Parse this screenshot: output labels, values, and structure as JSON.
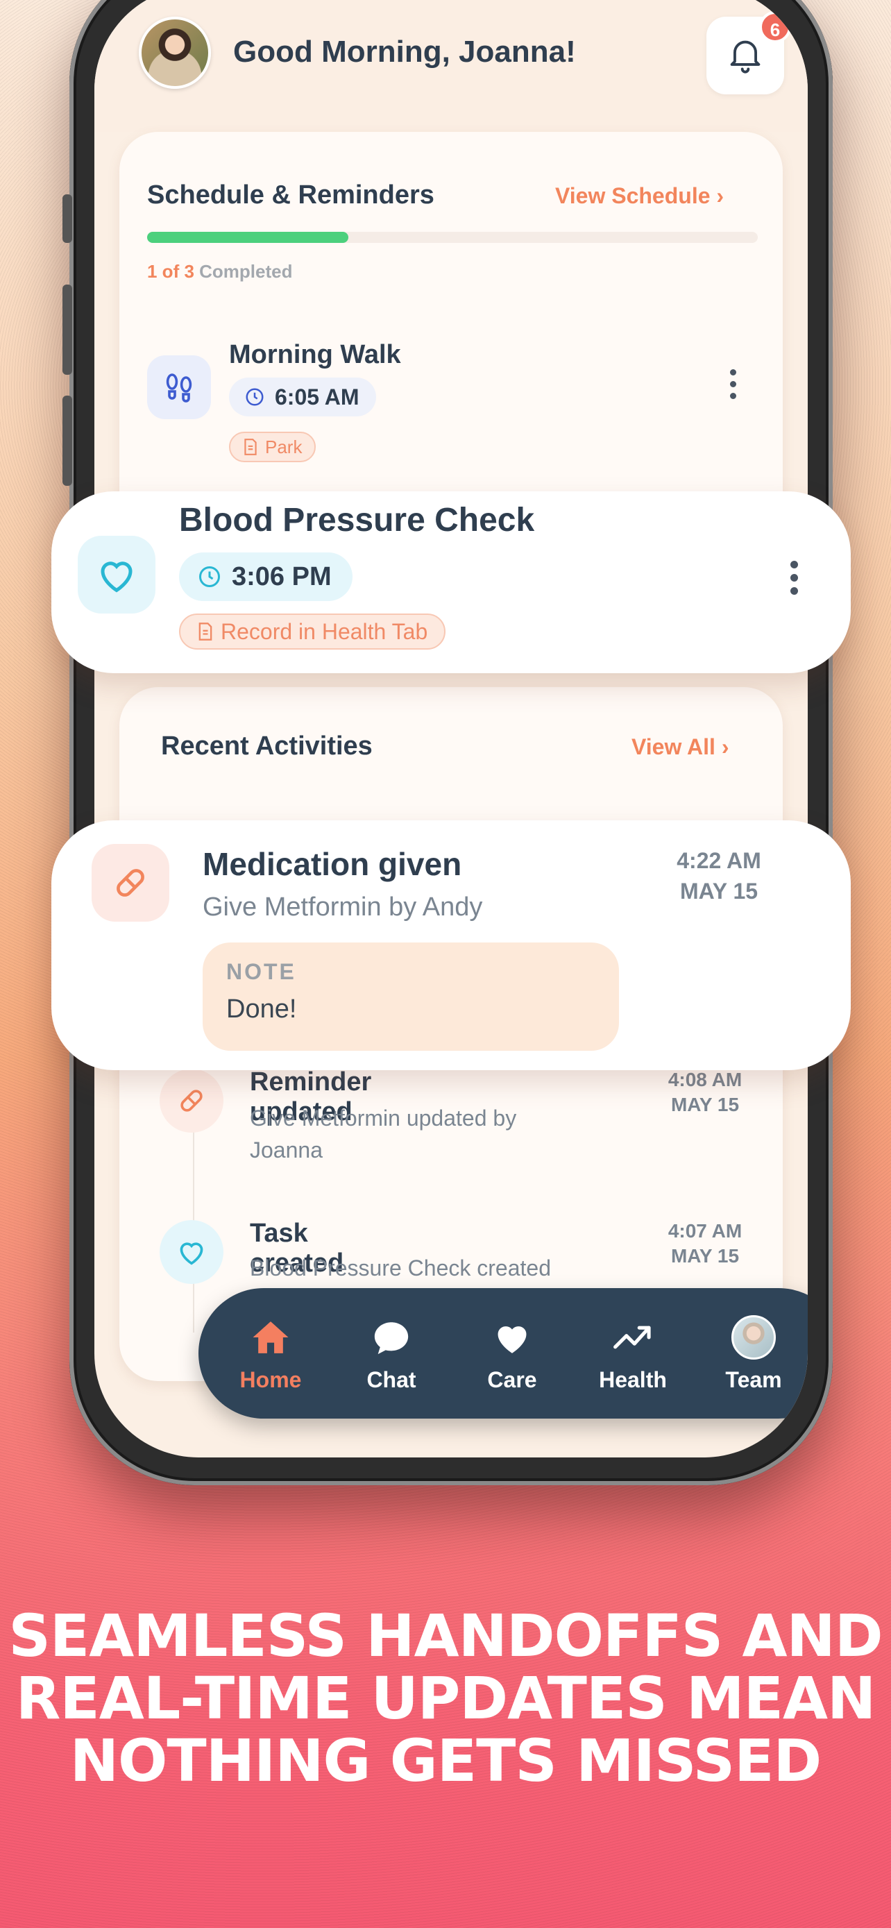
{
  "header": {
    "greeting": "Good Morning, Joanna!",
    "notification_count": "6"
  },
  "schedule": {
    "title": "Schedule & Reminders",
    "view_link": "View Schedule ›",
    "progress_fraction": 0.33,
    "completed_count": "1 of 3",
    "completed_suffix": " Completed",
    "items": [
      {
        "title": "Morning Walk",
        "time": "6:05 AM",
        "tag": "Park",
        "icon": "footsteps-icon"
      },
      {
        "title": "Blood Pressure Check",
        "time": "3:06 PM",
        "tag": "Record in Health Tab",
        "icon": "heart-icon"
      }
    ]
  },
  "recent": {
    "title": "Recent Activities",
    "view_link": "View All ›",
    "items": [
      {
        "title": "Medication given",
        "sub": "Give Metformin by Andy",
        "time": "4:22 AM",
        "date": "MAY 15",
        "note_label": "NOTE",
        "note": "Done!",
        "icon": "pill-icon"
      },
      {
        "title": "Reminder updated",
        "sub": "Give Metformin updated by Joanna",
        "time": "4:08 AM",
        "date": "MAY 15",
        "icon": "pill-icon"
      },
      {
        "title": "Task created",
        "sub": "Blood Pressure Check created",
        "time": "4:07 AM",
        "date": "MAY 15",
        "icon": "heart-icon"
      }
    ]
  },
  "tabs": [
    {
      "label": "Home",
      "icon": "home-icon",
      "active": true
    },
    {
      "label": "Chat",
      "icon": "chat-icon"
    },
    {
      "label": "Care",
      "icon": "heart-icon"
    },
    {
      "label": "Health",
      "icon": "trend-icon"
    },
    {
      "label": "Team",
      "icon": "avatar"
    }
  ],
  "caption": "SEAMLESS HANDOFFS AND REAL-TIME UPDATES MEAN NOTHING GETS MISSED",
  "colors": {
    "accent": "#f2855c",
    "navy": "#2f4458",
    "green": "#4cd07d",
    "cyan": "#29b7d3"
  }
}
